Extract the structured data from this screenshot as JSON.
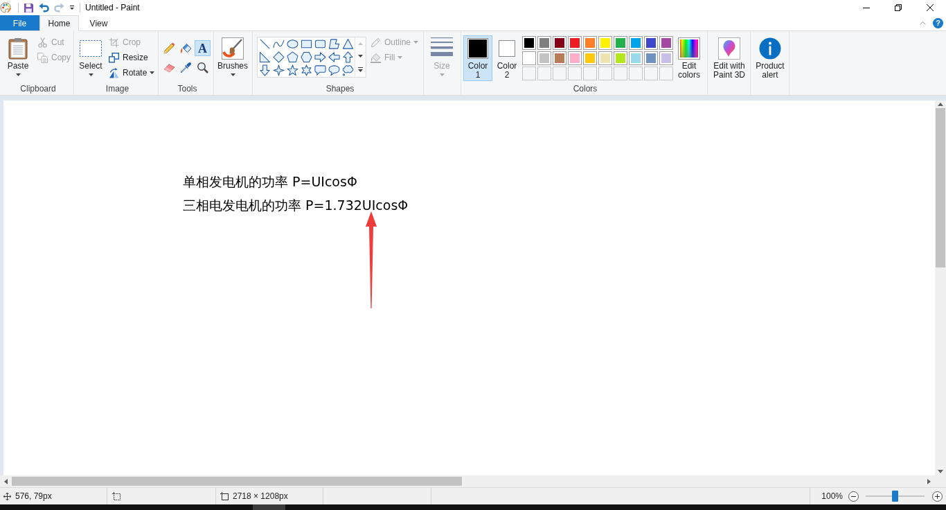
{
  "window": {
    "title": "Untitled - Paint"
  },
  "quick_access": [
    {
      "kind": "save",
      "disabled": false
    },
    {
      "kind": "undo",
      "disabled": false
    },
    {
      "kind": "redo",
      "disabled": true
    },
    {
      "kind": "customize",
      "disabled": false
    }
  ],
  "tabs": [
    {
      "label": "File",
      "kind": "file",
      "selected": false
    },
    {
      "label": "Home",
      "kind": "tab",
      "selected": true
    },
    {
      "label": "View",
      "kind": "tab",
      "selected": false
    }
  ],
  "help": {
    "label": "?"
  },
  "ribbon": {
    "clipboard": {
      "label": "Clipboard",
      "paste": {
        "label": "Paste"
      },
      "actions": [
        {
          "kind": "cut",
          "label": "Cut",
          "disabled": true
        },
        {
          "kind": "copy",
          "label": "Copy",
          "disabled": true
        }
      ]
    },
    "image": {
      "label": "Image",
      "select": {
        "label": "Select"
      },
      "actions": [
        {
          "kind": "crop",
          "label": "Crop",
          "disabled": true,
          "dropdown": false
        },
        {
          "kind": "resize",
          "label": "Resize",
          "disabled": false,
          "dropdown": false
        },
        {
          "kind": "rotate",
          "label": "Rotate",
          "disabled": false,
          "dropdown": true
        }
      ]
    },
    "tools": {
      "label": "Tools",
      "items": [
        {
          "kind": "pencil",
          "selected": false
        },
        {
          "kind": "fill",
          "selected": false
        },
        {
          "kind": "text",
          "glyph": "A",
          "selected": true
        },
        {
          "kind": "eraser",
          "selected": false
        },
        {
          "kind": "color-picker",
          "selected": false
        },
        {
          "kind": "magnifier",
          "selected": false
        }
      ]
    },
    "brushes": {
      "label": "Brushes"
    },
    "shapes": {
      "label": "Shapes",
      "gallery": [
        {
          "kind": "line"
        },
        {
          "kind": "curve"
        },
        {
          "kind": "oval"
        },
        {
          "kind": "rectangle"
        },
        {
          "kind": "rounded-rectangle"
        },
        {
          "kind": "polygon"
        },
        {
          "kind": "triangle"
        },
        {
          "kind": "right-triangle"
        },
        {
          "kind": "diamond"
        },
        {
          "kind": "pentagon"
        },
        {
          "kind": "hexagon"
        },
        {
          "kind": "right-arrow"
        },
        {
          "kind": "left-arrow"
        },
        {
          "kind": "up-arrow"
        },
        {
          "kind": "down-arrow"
        },
        {
          "kind": "four-point-star"
        },
        {
          "kind": "five-point-star"
        },
        {
          "kind": "six-point-star"
        },
        {
          "kind": "rounded-callout"
        },
        {
          "kind": "oval-callout"
        },
        {
          "kind": "cloud-callout"
        }
      ],
      "outline": {
        "label": "Outline",
        "disabled": true
      },
      "fill": {
        "label": "Fill",
        "disabled": true
      }
    },
    "size": {
      "label": "Size",
      "disabled": true
    },
    "colors": {
      "label": "Colors",
      "current": [
        {
          "label": "Color 1",
          "color": "#000000",
          "selected": true
        },
        {
          "label": "Color 2",
          "color": "#ffffff",
          "selected": false
        }
      ],
      "palette": [
        {
          "kind": "color",
          "color": "#000000"
        },
        {
          "kind": "color",
          "color": "#7f7f7f"
        },
        {
          "kind": "color",
          "color": "#880015"
        },
        {
          "kind": "color",
          "color": "#ed1c24"
        },
        {
          "kind": "color",
          "color": "#ff7f27"
        },
        {
          "kind": "color",
          "color": "#fff200"
        },
        {
          "kind": "color",
          "color": "#22b14c"
        },
        {
          "kind": "color",
          "color": "#00a2e8"
        },
        {
          "kind": "color",
          "color": "#3f48cc"
        },
        {
          "kind": "color",
          "color": "#a349a4"
        },
        {
          "kind": "color",
          "color": "#ffffff"
        },
        {
          "kind": "color",
          "color": "#c3c3c3"
        },
        {
          "kind": "color",
          "color": "#b97a57"
        },
        {
          "kind": "color",
          "color": "#ffaec9"
        },
        {
          "kind": "color",
          "color": "#ffc90e"
        },
        {
          "kind": "color",
          "color": "#efe4b0"
        },
        {
          "kind": "color",
          "color": "#b5e61d"
        },
        {
          "kind": "color",
          "color": "#99d9ea"
        },
        {
          "kind": "color",
          "color": "#7092be"
        },
        {
          "kind": "color",
          "color": "#c8bfe7"
        },
        {
          "kind": "empty"
        },
        {
          "kind": "empty"
        },
        {
          "kind": "empty"
        },
        {
          "kind": "empty"
        },
        {
          "kind": "empty"
        },
        {
          "kind": "empty"
        },
        {
          "kind": "empty"
        },
        {
          "kind": "empty"
        },
        {
          "kind": "empty"
        },
        {
          "kind": "empty"
        }
      ],
      "edit": {
        "label": "Edit colors"
      }
    },
    "paint3d": {
      "label": "Edit with Paint 3D"
    },
    "product_alert": {
      "label": "Product alert"
    }
  },
  "canvas": {
    "lines": [
      "单相发电机的功率 P=UIcosΦ",
      "三相电发电机的功率 P=1.732UIcosΦ"
    ]
  },
  "status_bar": {
    "cursor_position": "576, 79px",
    "image_size": "2718 × 1208px",
    "zoom": {
      "reading": "100%",
      "level": 0.5
    }
  }
}
